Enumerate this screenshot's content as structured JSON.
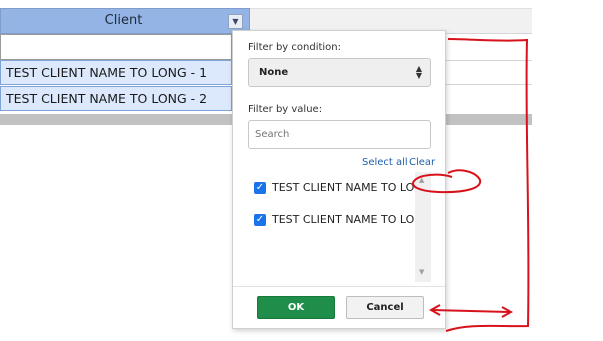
{
  "grid": {
    "header": {
      "client_label": "Client",
      "menu_icon": "dropdown-arrow-icon"
    },
    "rows": [
      {
        "client": "TEST CLIENT NAME TO LONG - 1"
      },
      {
        "client": "TEST CLIENT NAME TO LONG - 2"
      }
    ]
  },
  "filter_menu": {
    "condition_label": "Filter by condition:",
    "condition_value": "None",
    "value_label": "Filter by value:",
    "search_placeholder": "Search",
    "select_all": "Select all",
    "clear": "Clear",
    "items": [
      {
        "label": "TEST CLIENT NAME TO LO",
        "checked": true
      },
      {
        "label": "TEST CLIENT NAME TO LO",
        "checked": true
      }
    ],
    "ok_label": "OK",
    "cancel_label": "Cancel"
  },
  "colors": {
    "header_bg": "#94b4e6",
    "row_bg": "#dce8fb",
    "ok_bg": "#1e8e4a",
    "checkbox": "#1a73e8",
    "annotation": "#d8121b"
  }
}
